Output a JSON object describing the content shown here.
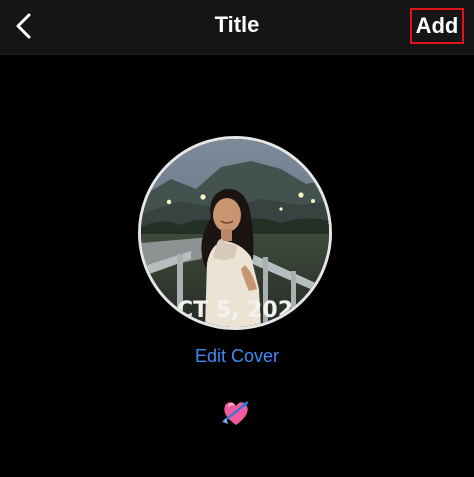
{
  "nav": {
    "title": "Title",
    "add_label": "Add",
    "back_icon": "chevron-left-icon"
  },
  "cover": {
    "overlay_text": "CT 5, 202",
    "image": "profile-cover-photo"
  },
  "edit_cover_label": "Edit Cover",
  "emoji": {
    "icon": "heart-with-arrow-emoji"
  },
  "colors": {
    "background": "#000000",
    "nav_background": "#151515",
    "link_blue": "#3b8cf5",
    "highlight_red": "#e0141c"
  }
}
